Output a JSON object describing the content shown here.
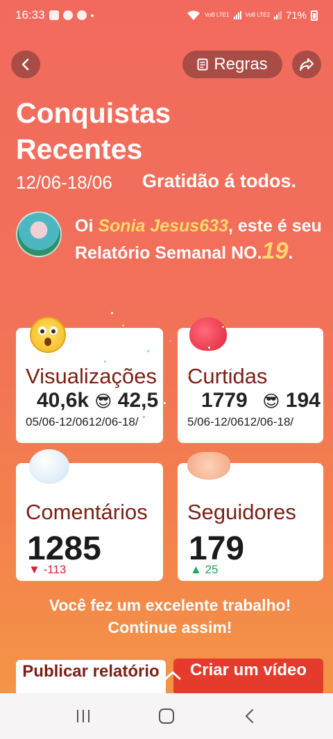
{
  "status_bar": {
    "time": "16:33",
    "network1": "VoB LTE1",
    "network2": "VoB LTE2",
    "battery": "71%"
  },
  "header": {
    "rules_label": "Regras",
    "title": "Conquistas Recentes",
    "date_range": "12/06-18/06",
    "gratitude": "Gratidão á todos."
  },
  "greeting": {
    "prefix": "Oi",
    "username": "Sonia Jesus633",
    "middle": ", este é seu Relatório Semanal NO.",
    "week_number": "19",
    "suffix": "."
  },
  "cards": {
    "views": {
      "label": "Visualizações",
      "previous": "40,6k",
      "current": "42,5",
      "previous_range": "05/06-12/06",
      "current_range": "12/06-18/"
    },
    "likes": {
      "label": "Curtidas",
      "previous": "1779",
      "current": "194",
      "previous_range": "5/06-12/06",
      "current_range": "12/06-18/"
    },
    "comments": {
      "label": "Comentários",
      "value": "1285",
      "delta": "-113"
    },
    "followers": {
      "label": "Seguidores",
      "value": "179",
      "delta": "25"
    }
  },
  "message": {
    "line1": "Você fez um excelente trabalho!",
    "line2": "Continue assim!"
  },
  "buttons": {
    "publish": "Publicar relatório",
    "create": "Criar um vídeo"
  },
  "colors": {
    "accent_red": "#e53b2c",
    "label_brown": "#7a1f14",
    "highlight_yellow": "#ffd86b",
    "down_red": "#d9213a",
    "up_green": "#1ea85a"
  }
}
